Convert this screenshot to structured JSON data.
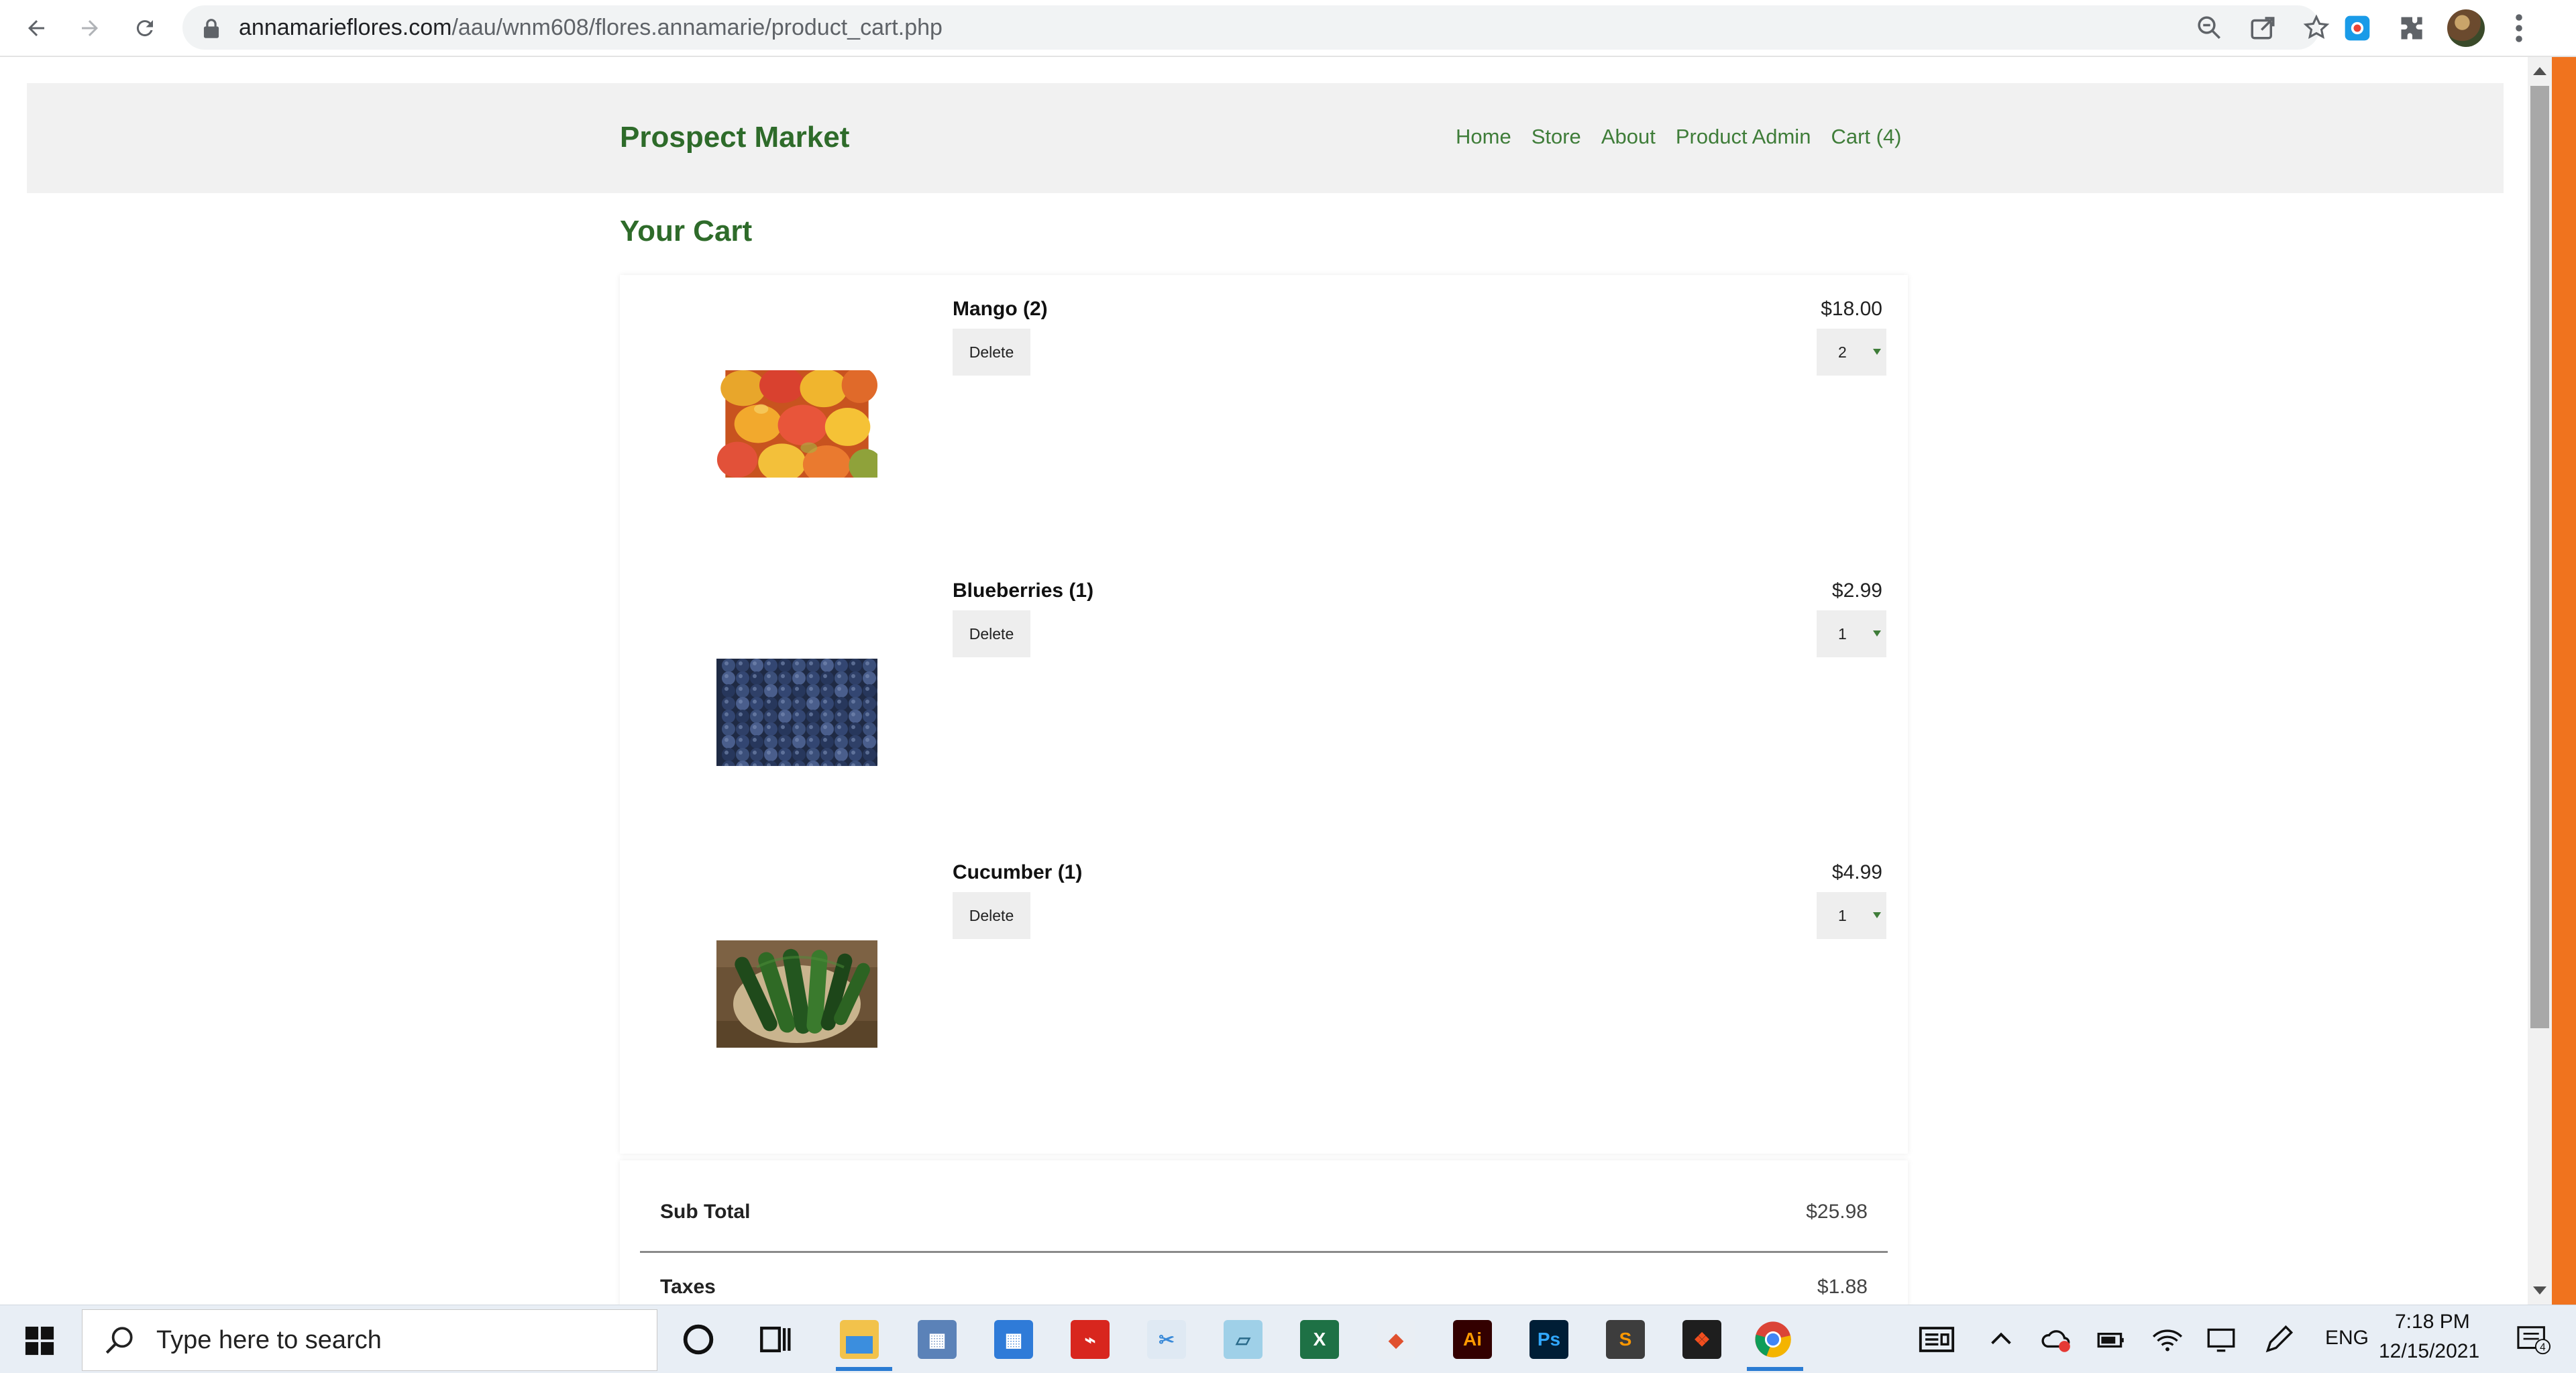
{
  "browser": {
    "url_domain": "annamarieflores.com",
    "url_path": "/aau/wnm608/flores.annamarie/product_cart.php"
  },
  "site": {
    "brand": "Prospect Market",
    "nav": [
      {
        "label": "Home"
      },
      {
        "label": "Store"
      },
      {
        "label": "About"
      },
      {
        "label": "Product Admin"
      },
      {
        "label": "Cart (4)"
      }
    ]
  },
  "cart": {
    "title": "Your Cart",
    "delete_label": "Delete",
    "items": [
      {
        "name": "Mango (2)",
        "price": "$18.00",
        "qty": "2",
        "image": "mango-photo"
      },
      {
        "name": "Blueberries (1)",
        "price": "$2.99",
        "qty": "1",
        "image": "blueberries-photo"
      },
      {
        "name": "Cucumber (1)",
        "price": "$4.99",
        "qty": "1",
        "image": "cucumber-photo"
      }
    ]
  },
  "totals": {
    "subtotal_label": "Sub Total",
    "subtotal_value": "$25.98",
    "taxes_label": "Taxes",
    "taxes_value": "$1.88"
  },
  "taskbar": {
    "search_placeholder": "Type here to search",
    "language": "ENG",
    "time": "7:18 PM",
    "date": "12/15/2021",
    "notifications": "4",
    "apps": [
      "cortana-icon",
      "task-view-icon",
      "file-explorer-icon",
      "calculator-icon",
      "calendar-icon",
      "acrobat-icon",
      "snipping-tool-icon",
      "notepad-icon",
      "excel-icon",
      "paint-icon",
      "illustrator-icon",
      "photoshop-icon",
      "sublime-icon",
      "figma-icon",
      "chrome-icon"
    ]
  },
  "colors": {
    "brand_green": "#2e6b2a",
    "nav_green": "#3f7d39",
    "header_bg": "#f1f1f1",
    "accent_strip": "#f0731e"
  }
}
